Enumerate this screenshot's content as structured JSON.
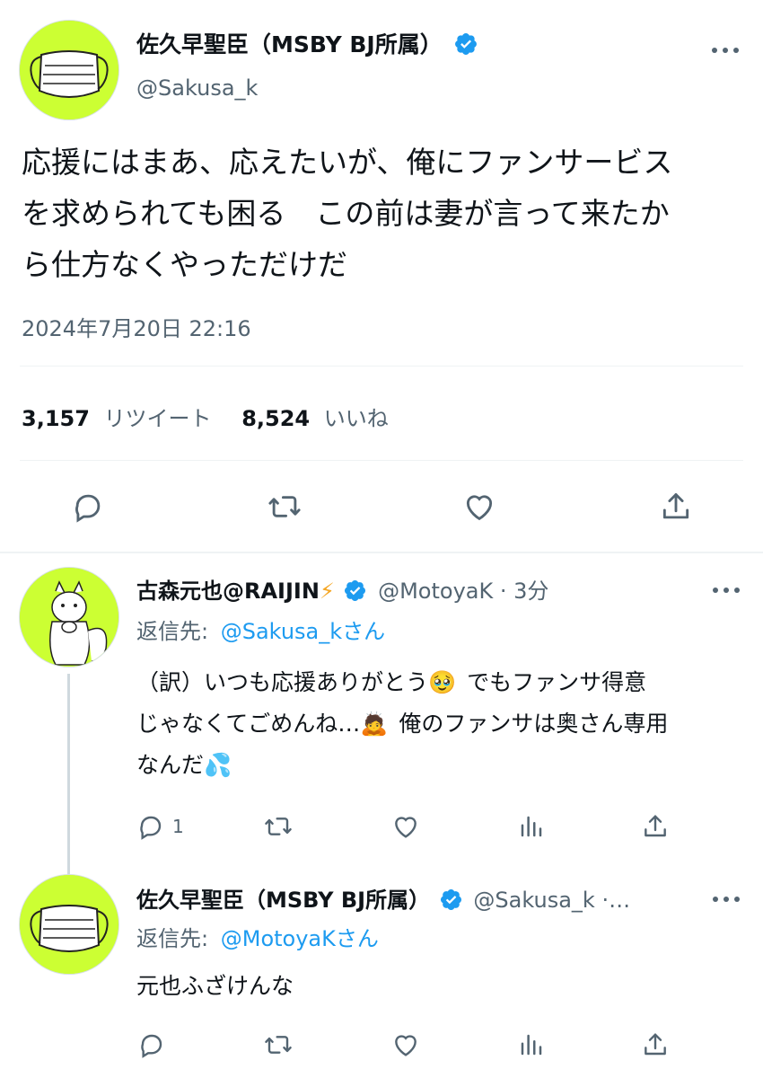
{
  "main_tweet": {
    "display_name": "佐久早聖臣（MSBY BJ所属）",
    "handle": "@Sakusa_k",
    "text_lines": [
      "応援にはまあ、応えたいが、俺にファンサービス",
      "を求められても困る　この前は妻が言って来たか",
      "ら仕方なくやっただけだ"
    ],
    "timestamp": "2024年7月20日 22:16",
    "retweet_count": "3,157",
    "retweet_label": "リツイート",
    "like_count": "8,524",
    "like_label": "いいね"
  },
  "reply1": {
    "display_name": "古森元也@RAIJIN",
    "name_emoji": "⚡",
    "handle": "@MotoyaK",
    "separator": "·",
    "time": "3分",
    "reply_to_prefix": "返信先:",
    "reply_to_handle": "@Sakusa_kさん",
    "text_line1a": "（訳）いつも応援ありがとう",
    "text_line1b": "でもファンサ得意",
    "text_line2a": "じゃなくてごめんね…",
    "text_line2b": "俺のファンサは奥さん専用",
    "text_line3a": "なんだ",
    "emoji_1": "🥹",
    "emoji_2": "🙇",
    "emoji_3": "💦",
    "reply_count": "1"
  },
  "reply2": {
    "display_name": "佐久早聖臣（MSBY BJ所属）",
    "handle": "@Sakusa_k ·…",
    "reply_to_prefix": "返信先:",
    "reply_to_handle": "@MotoyaKさん",
    "text": "元也ふざけんな"
  },
  "colors": {
    "accent": "#1d9bf0",
    "secondary_text": "#536471",
    "avatar_bg": "#ccff33"
  },
  "icons": {
    "reply": "reply-icon",
    "retweet": "retweet-icon",
    "like": "heart-icon",
    "share": "share-icon",
    "views": "views-icon",
    "more": "more-icon",
    "verified": "verified-badge-icon"
  }
}
